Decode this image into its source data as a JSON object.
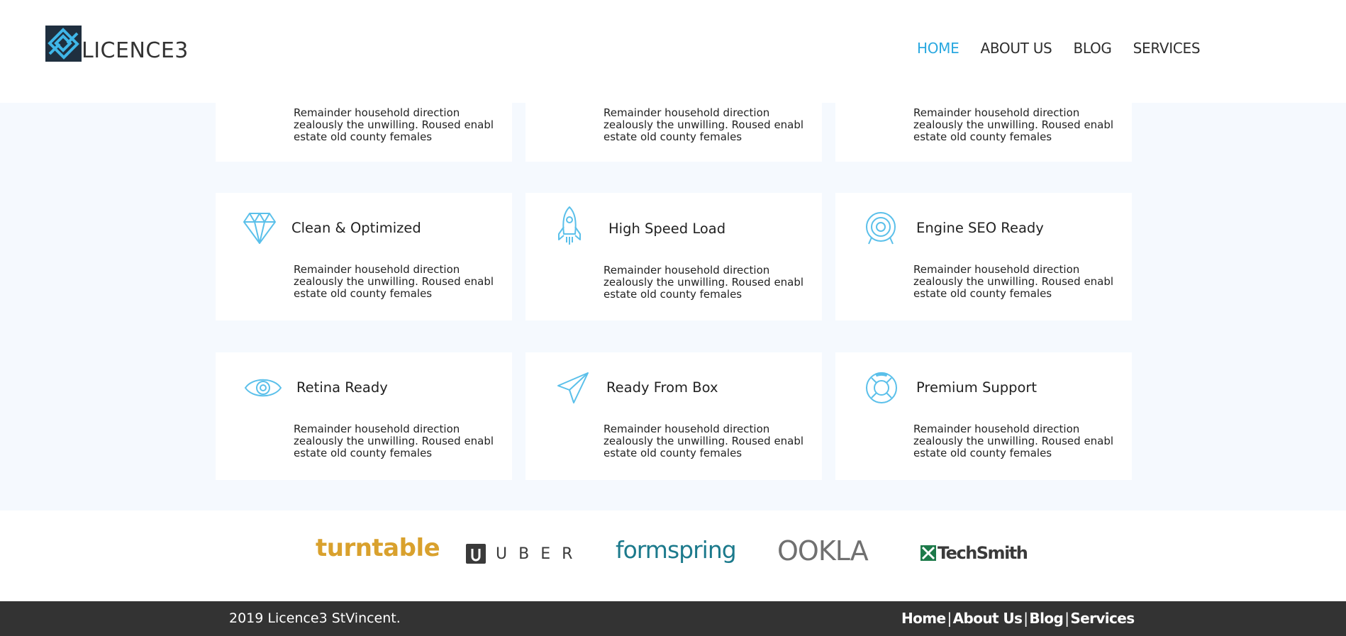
{
  "brand": {
    "name": "LICENCE3"
  },
  "nav": {
    "items": [
      "HOME",
      "ABOUT US",
      "BLOG",
      "SERVICES"
    ],
    "active": "HOME"
  },
  "features": {
    "description": "Remainder household direction zealously the unwilling. Roused enabl estate old county females",
    "row1": [
      {
        "description": "Remainder household direction zealously the unwilling. Roused enabl estate old county females"
      },
      {
        "description": "Remainder household direction zealously the unwilling. Roused enabl estate old county females"
      },
      {
        "description": "Remainder household direction zealously the unwilling. Roused enabl estate old county females"
      }
    ],
    "cards": [
      {
        "title": "Clean & Optimized",
        "icon": "diamond-icon",
        "description": "Remainder household direction zealously the unwilling. Roused enabl estate old county females"
      },
      {
        "title": "High Speed Load",
        "icon": "rocket-icon",
        "description": "Remainder household direction zealously the unwilling. Roused enabl estate old county females"
      },
      {
        "title": "Engine SEO Ready",
        "icon": "target-icon",
        "description": "Remainder household direction zealously the unwilling. Roused enabl estate old county females"
      },
      {
        "title": "Retina Ready",
        "icon": "eye-icon",
        "description": "Remainder household direction zealously the unwilling. Roused enabl estate old county females"
      },
      {
        "title": "Ready From Box",
        "icon": "paper-plane-icon",
        "description": "Remainder household direction zealously the unwilling. Roused enabl estate old county females"
      },
      {
        "title": "Premium Support",
        "icon": "lifebuoy-icon",
        "description": "Remainder household direction zealously the unwilling. Roused enabl estate old county females"
      }
    ]
  },
  "brands": [
    "turntable",
    "UBER",
    "formspring",
    "OOKLA",
    "TechSmith"
  ],
  "footer": {
    "copyright": "2019 Licence3 StVincent.",
    "links": [
      "Home",
      "About Us",
      "Blog",
      "Services"
    ],
    "separator": "|"
  },
  "colors": {
    "accent": "#29a8e0",
    "icon": "#5bc0ea",
    "footer_bg": "#333333",
    "section_bg": "#f5f9fe"
  }
}
